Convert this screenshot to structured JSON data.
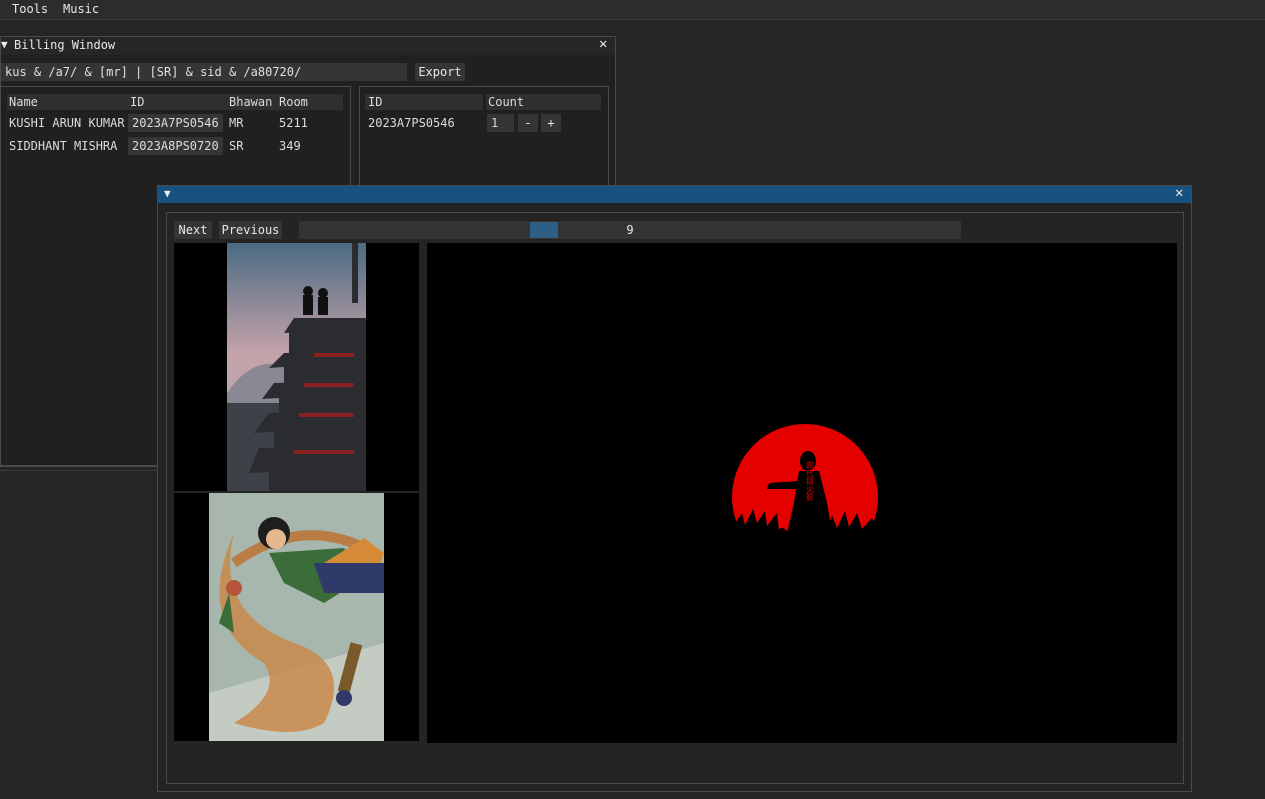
{
  "menubar": {
    "items": [
      "Tools",
      "Music"
    ]
  },
  "billing": {
    "title": "Billing Window",
    "search_value": "kus & /a7/ & [mr] | [SR] & sid & /a80720/",
    "export_label": "Export",
    "students_table": {
      "headers": [
        "Name",
        "ID",
        "Bhawan",
        "Room"
      ],
      "rows": [
        [
          "KUSHI ARUN KUMAR",
          "2023A7PS0546",
          "MR",
          "5211"
        ],
        [
          "SIDDHANT MISHRA",
          "2023A8PS0720",
          "SR",
          "349"
        ]
      ]
    },
    "count_table": {
      "headers": [
        "ID",
        "Count"
      ],
      "rows": [
        {
          "id": "2023A7PS0546",
          "count": "1",
          "minus": "-",
          "plus": "+"
        }
      ]
    }
  },
  "viewer": {
    "next_label": "Next",
    "previous_label": "Previous",
    "slider_value": "9",
    "images": [
      "pagoda-thumbnail",
      "martial-artist-thumbnail",
      "red-moon-silhouette"
    ],
    "moon_text": "四代目火影"
  },
  "colors": {
    "title_active": "#17517f",
    "slider_grab": "#2d5f86",
    "moon": "#e50000"
  }
}
